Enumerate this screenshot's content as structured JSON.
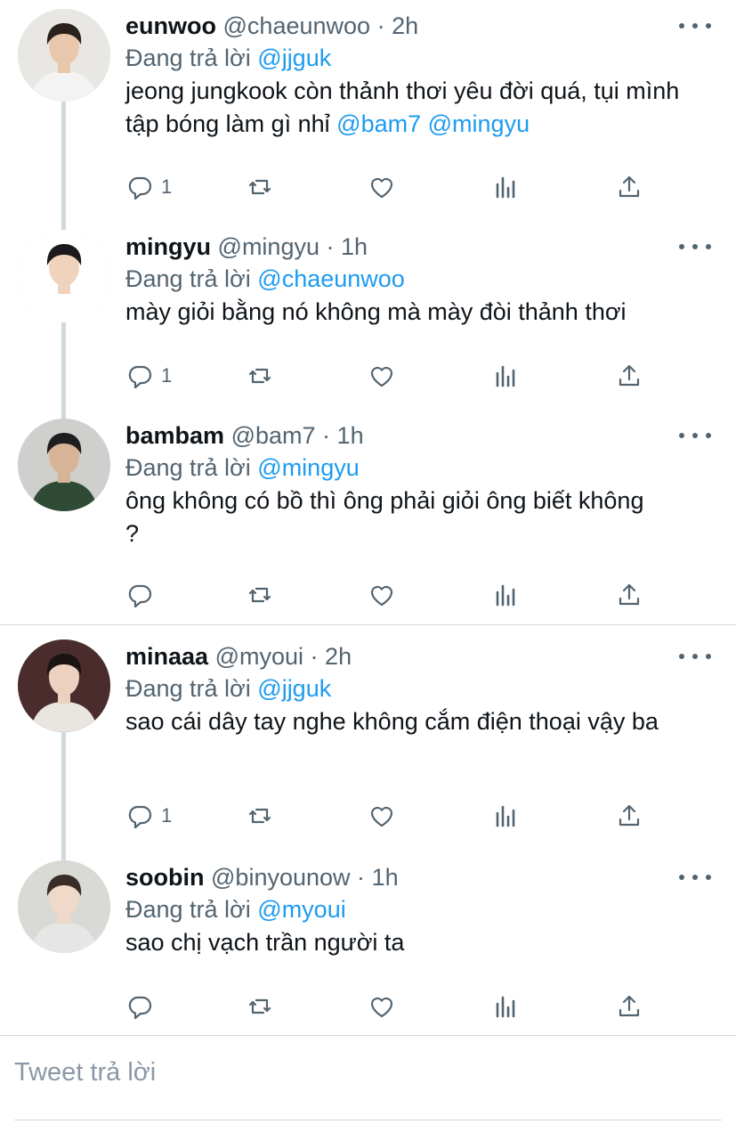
{
  "replying_prefix": "Đang trả lời",
  "tweets": [
    {
      "name": "eunwoo",
      "handle": "@chaeunwoo",
      "dot": "·",
      "time": "2h",
      "reply_to": "@jjguk",
      "text_parts": [
        {
          "t": "jeong jungkook còn thảnh thơi yêu đời quá, tụi mình tập bóng làm gì nhỉ ",
          "m": false
        },
        {
          "t": "@bam7",
          "m": true
        },
        {
          "t": " ",
          "m": false
        },
        {
          "t": "@mingyu",
          "m": true
        }
      ],
      "reply_count": "1",
      "avatar_colors": {
        "bg": "#e9e7e3",
        "skin": "#e8c7ac",
        "hair": "#2b211c",
        "cloth": "#f3f3f3"
      }
    },
    {
      "name": "mingyu",
      "handle": "@mingyu",
      "dot": "·",
      "time": "1h",
      "reply_to": "@chaeunwoo",
      "text_parts": [
        {
          "t": "mày giỏi bằng nó không mà mày đòi thảnh thơi",
          "m": false
        }
      ],
      "reply_count": "1",
      "avatar_colors": {
        "bg": "#ffffff",
        "skin": "#f0d3bd",
        "hair": "#1c1a1a",
        "cloth": "#ffffff"
      }
    },
    {
      "name": "bambam",
      "handle": "@bam7",
      "dot": "·",
      "time": "1h",
      "reply_to": "@mingyu",
      "text_parts": [
        {
          "t": "ông không có bồ thì ông phải giỏi ông biết không ?",
          "m": false
        }
      ],
      "reply_count": "",
      "avatar_colors": {
        "bg": "#cfcfcd",
        "skin": "#d8b497",
        "hair": "#1e1e1e",
        "cloth": "#2f4b36"
      }
    },
    {
      "name": "minaaa",
      "handle": "@myoui",
      "dot": "·",
      "time": "2h",
      "reply_to": "@jjguk",
      "text_parts": [
        {
          "t": "sao cái dây tay nghe không cắm điện thoại vậy ba",
          "m": false
        }
      ],
      "reply_count": "1",
      "avatar_colors": {
        "bg": "#4a2c2c",
        "skin": "#ecd1c0",
        "hair": "#1a1414",
        "cloth": "#e9e6e2"
      }
    },
    {
      "name": "soobin",
      "handle": "@binyounow",
      "dot": "·",
      "time": "1h",
      "reply_to": "@myoui",
      "text_parts": [
        {
          "t": "sao chị vạch trần người ta",
          "m": false
        }
      ],
      "reply_count": "",
      "avatar_colors": {
        "bg": "#d9d9d6",
        "skin": "#efd9c8",
        "hair": "#3a2c26",
        "cloth": "#e6e6e6"
      }
    }
  ],
  "icons": {
    "reply": "reply-icon",
    "retweet": "retweet-icon",
    "like": "heart-icon",
    "views": "views-icon",
    "share": "share-icon",
    "more": "more-icon"
  },
  "colors": {
    "link": "#1d9bf0",
    "muted": "#536471",
    "line": "#cfd9de"
  },
  "compose": {
    "placeholder": "Tweet trả lời"
  }
}
